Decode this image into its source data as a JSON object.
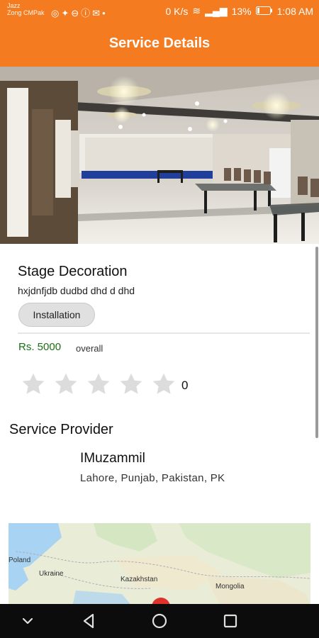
{
  "status_bar": {
    "carrier_line1": "Jazz",
    "carrier_line2": "Zong CMPak",
    "speed": "0 K/s",
    "battery": "13%",
    "time": "1:08 AM"
  },
  "app_bar": {
    "title": "Service Details"
  },
  "service": {
    "title": "Stage Decoration",
    "description": "hxjdnfjdb dudbd dhd d dhd",
    "category": "Installation",
    "price": "Rs. 5000",
    "price_note": "overall",
    "rating": 0,
    "rating_count": "0"
  },
  "provider": {
    "heading": "Service Provider",
    "name": "IMuzammil",
    "location": "Lahore, Punjab, Pakistan, PK"
  },
  "map": {
    "labels": [
      "Poland",
      "Ukraine",
      "Kazakhstan",
      "Mongolia"
    ]
  },
  "colors": {
    "primary": "#f47b1f",
    "price": "#1b6e16",
    "star_empty": "#dcdcdc",
    "nav_bar": "#0c0c0c"
  }
}
